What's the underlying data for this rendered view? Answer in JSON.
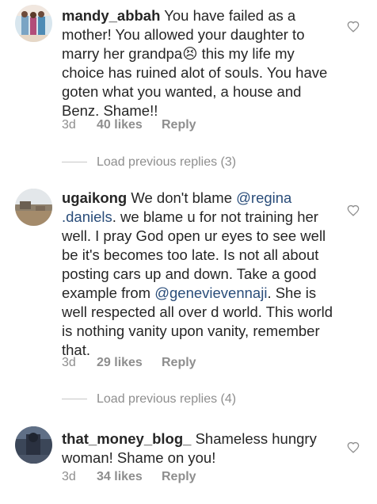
{
  "comments": [
    {
      "username": "mandy_abbah",
      "text_parts": [
        " You have failed as a mother! You allowed your daughter to marry her grandpa",
        "😣",
        " this my life my choice has ruined alot of souls. You have goten what you wanted, a house and Benz. Shame!!"
      ],
      "time": "3d",
      "likes": "40 likes",
      "reply": "Reply"
    },
    {
      "username": "ugaikong",
      "text_parts": [
        " We don't blame ",
        "@regina .daniels",
        ". we blame u for not training her well. I pray God open ur eyes to see well be it's becomes too late. Is not all about posting cars up and down. Take a good example from ",
        "@genevievennaji",
        ". She is well respected all over d world. This world is nothing vanity upon vanity, remember that."
      ],
      "time": "3d",
      "likes": "29 likes",
      "reply": "Reply"
    },
    {
      "username": "that_money_blog_",
      "text_parts": [
        " Shameless hungry woman! Shame on you!"
      ],
      "time": "3d",
      "likes": "34 likes",
      "reply": "Reply"
    }
  ],
  "load_replies": [
    "Load previous replies (3)",
    "Load previous replies (4)"
  ],
  "colors": {
    "text": "#262626",
    "meta": "#8e8e8e",
    "mention": "#2a4d7a",
    "divider": "#c7c7c7"
  },
  "icons": {
    "like": "heart-outline-icon"
  }
}
